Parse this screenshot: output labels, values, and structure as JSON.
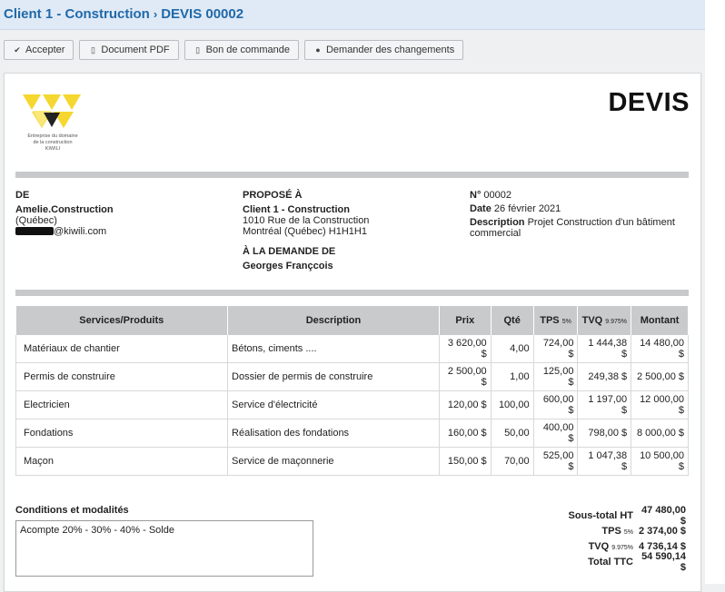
{
  "breadcrumb": {
    "client": "Client 1 - Construction",
    "separator": "›",
    "doc": "DEVIS 00002"
  },
  "toolbar": {
    "accept": "Accepter",
    "pdf": "Document PDF",
    "order": "Bon de commande",
    "changes": "Demander des changements"
  },
  "logo": {
    "lines": [
      "Entreprise du domaine",
      "de la construction",
      "KIWILI"
    ]
  },
  "doc_title": "DEVIS",
  "from": {
    "heading": "DE",
    "name": "Amelie.Construction",
    "region": "(Québec)",
    "email_suffix": "@kiwili.com"
  },
  "to": {
    "heading": "PROPOSÉ À",
    "name": "Client 1 - Construction",
    "address1": "1010 Rue de la Construction",
    "address2": "Montréal (Québec) H1H1H1",
    "request_heading": "À LA DEMANDE DE",
    "requester": "Georges Françcois"
  },
  "meta": {
    "number_label": "N°",
    "number": "00002",
    "date_label": "Date",
    "date": "26 février 2021",
    "desc_label": "Description",
    "desc": "Projet Construction d'un bâtiment commercial"
  },
  "table": {
    "headers": {
      "service": "Services/Produits",
      "description": "Description",
      "price": "Prix",
      "qty": "Qté",
      "tps": "TPS",
      "tps_rate": "5%",
      "tvq": "TVQ",
      "tvq_rate": "9.975%",
      "amount": "Montant"
    },
    "rows": [
      {
        "service": "Matériaux de chantier",
        "description": "Bétons, ciments ....",
        "price": "3 620,00 $",
        "qty": "4,00",
        "tps": "724,00 $",
        "tvq": "1 444,38 $",
        "amount": "14 480,00 $"
      },
      {
        "service": "Permis de construire",
        "description": "Dossier de permis de construire",
        "price": "2 500,00 $",
        "qty": "1,00",
        "tps": "125,00 $",
        "tvq": "249,38 $",
        "amount": "2 500,00 $"
      },
      {
        "service": "Electricien",
        "description": "Service d'électricité",
        "price": "120,00 $",
        "qty": "100,00",
        "tps": "600,00 $",
        "tvq": "1 197,00 $",
        "amount": "12 000,00 $"
      },
      {
        "service": "Fondations",
        "description": "Réalisation des fondations",
        "price": "160,00 $",
        "qty": "50,00",
        "tps": "400,00 $",
        "tvq": "798,00 $",
        "amount": "8 000,00 $"
      },
      {
        "service": "Maçon",
        "description": "Service de maçonnerie",
        "price": "150,00 $",
        "qty": "70,00",
        "tps": "525,00 $",
        "tvq": "1 047,38 $",
        "amount": "10 500,00 $"
      }
    ]
  },
  "conditions": {
    "label": "Conditions et modalités",
    "text": "Acompte 20% - 30% - 40% - Solde"
  },
  "totals": {
    "subtotal_label": "Sous-total HT",
    "subtotal": "47 480,00 $",
    "tps_label": "TPS",
    "tps_rate": "5%",
    "tps": "2 374,00 $",
    "tvq_label": "TVQ",
    "tvq_rate": "9.975%",
    "tvq": "4 736,14 $",
    "total_label": "Total TTC",
    "total": "54 590,14 $"
  },
  "colors": {
    "header_bg": "#dfeaf6",
    "link": "#2169a8",
    "logo_yellow": "#f5d730"
  }
}
